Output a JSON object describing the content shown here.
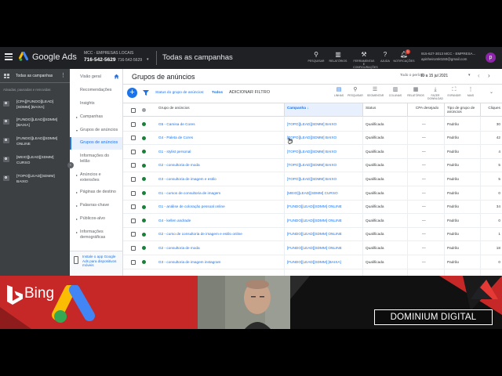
{
  "app": {
    "brand": "Google Ads",
    "account_line1": "MCC - EMPRESAS LOCAIS",
    "account_line2": "716-542-5629",
    "account_line3": "716-542-5629",
    "title": "Todas as campanhas",
    "tools": [
      {
        "label": "PESQUISAR",
        "icon": "search-icon"
      },
      {
        "label": "RELATÓRIOS",
        "icon": "reports-icon"
      },
      {
        "label": "FERRAMENTAS E CONFIGURAÇÕES",
        "icon": "tools-icon"
      },
      {
        "label": "AJUDA",
        "icon": "help-icon"
      },
      {
        "label": "NOTIFICAÇÕES",
        "icon": "bell-icon"
      }
    ],
    "notifications_badge": "1",
    "user_line1": "915-627-3013 MCC - EMPRESA...",
    "user_line2": "apinheiromkt150@gmail.com",
    "avatar_letter": "p"
  },
  "left_panel": {
    "title": "Todas as campanhas",
    "filter_text": "Ativadas, pausadas e removidas",
    "campaigns": [
      "[CPA][FUNDO][LEAD][SDMM] [BAIXA]",
      "[FUNDO][LEAD][SDMM] [BAIXA]",
      "[FUNDO][LEAD][SDMM] ONLINE",
      "[MEIO][LEAD][SDMM] CURSO",
      "[TOPO][LEAD][SDMM] BAIXO"
    ]
  },
  "nav": {
    "items": [
      {
        "label": "Visão geral",
        "arrow": ""
      },
      {
        "label": "Recomendações",
        "arrow": ""
      },
      {
        "label": "Insights",
        "arrow": ""
      },
      {
        "label": "Campanhas",
        "arrow": "▸"
      },
      {
        "label": "Grupos de anúncios",
        "arrow": "▾"
      },
      {
        "label": "Grupos de anúncios",
        "arrow": ""
      },
      {
        "label": "Informações do leilão",
        "arrow": ""
      },
      {
        "label": "Anúncios e extensões",
        "arrow": "▸"
      },
      {
        "label": "Páginas de destino",
        "arrow": "▸"
      },
      {
        "label": "Palavras-chave",
        "arrow": "▸"
      },
      {
        "label": "Públicos-alvo",
        "arrow": "▸"
      },
      {
        "label": "Informações demográficas",
        "arrow": "▸"
      }
    ],
    "bottom_text": "Instale o app Google Ads para dispositivos móveis"
  },
  "main": {
    "page_title": "Grupos de anúncios",
    "period_label": "Todo o período",
    "period_value": "11 a 15 jul 2021",
    "filter_text": "Status do grupo de anúncios:",
    "filter_value": "Todos",
    "add_filter": "ADICIONAR FILTRO",
    "tools": [
      {
        "label": "LINHAS",
        "icon": "rows-icon"
      },
      {
        "label": "PESQUISAR",
        "icon": "search-icon"
      },
      {
        "label": "SEGMENTAR",
        "icon": "segment-icon"
      },
      {
        "label": "COLUNAS",
        "icon": "columns-icon"
      },
      {
        "label": "RELATÓRIOS",
        "icon": "reports-icon"
      },
      {
        "label": "FAZER DOWNLOAD",
        "icon": "download-icon"
      },
      {
        "label": "EXPANDIR",
        "icon": "expand-icon"
      },
      {
        "label": "MAIS",
        "icon": "more-icon"
      }
    ],
    "table": {
      "headers": {
        "group": "Grupo de anúncios",
        "campaign": "Campanha",
        "status": "Status",
        "cpa": "CPA desejado",
        "type": "Tipo de grupo de anúncios",
        "clicks": "Cliques"
      },
      "rows": [
        {
          "group": "G5 - Camisa de Cores",
          "campaign": "[TOPO][LEAD][SDMM] BAIXO",
          "status": "Qualificada",
          "cpa": "—",
          "type": "Padrão",
          "clicks": "30"
        },
        {
          "group": "G4 - Paleta de Cores",
          "campaign": "[TOPO][LEAD][SDMM] BAIXO",
          "status": "Qualificada",
          "cpa": "—",
          "type": "Padrão",
          "clicks": "42"
        },
        {
          "group": "G1 - stylist personal",
          "campaign": "[TOPO][LEAD][SDMM] BAIXO",
          "status": "Qualificada",
          "cpa": "—",
          "type": "Padrão",
          "clicks": "4"
        },
        {
          "group": "G2 - consultoria de moda",
          "campaign": "[TOPO][LEAD][SDMM] BAIXO",
          "status": "Qualificada",
          "cpa": "—",
          "type": "Padrão",
          "clicks": "5"
        },
        {
          "group": "G3 - consultoria de imagem e estilo",
          "campaign": "[TOPO][LEAD][SDMM] BAIXO",
          "status": "Qualificada",
          "cpa": "—",
          "type": "Padrão",
          "clicks": "5"
        },
        {
          "group": "G1 - cursos de consultoria de imagem",
          "campaign": "[MEIO][LEAD][SDMM] CURSO",
          "status": "Qualificada",
          "cpa": "—",
          "type": "Padrão",
          "clicks": "0"
        },
        {
          "group": "G1 - análise de coloração pessoal online",
          "campaign": "[FUNDO][LEAD][SDMM] ONLINE",
          "status": "Qualificada",
          "cpa": "—",
          "type": "Padrão",
          "clicks": "34"
        },
        {
          "group": "G4 - kellen andrade",
          "campaign": "[FUNDO][LEAD][SDMM] ONLINE",
          "status": "Qualificada",
          "cpa": "—",
          "type": "Padrão",
          "clicks": "0"
        },
        {
          "group": "G2 - curso de consultoria de imagem e estilo online",
          "campaign": "[FUNDO][LEAD][SDMM] ONLINE",
          "status": "Qualificada",
          "cpa": "—",
          "type": "Padrão",
          "clicks": "1"
        },
        {
          "group": "G2 - consultoria de moda",
          "campaign": "[FUNDO][LEAD][SDMM] ONLINE",
          "status": "Qualificada",
          "cpa": "—",
          "type": "Padrão",
          "clicks": "18"
        },
        {
          "group": "G3 - consultoria de imagem instagram",
          "campaign": "[FUNDO][LEAD][SDMM] [BAIXA]",
          "status": "Qualificada",
          "cpa": "—",
          "type": "Padrão",
          "clicks": "0"
        }
      ]
    }
  },
  "overlay": {
    "bing_label": "Bing",
    "brand_label": "DOMINIUM DIGITAL",
    "colors": {
      "band": "#c62828",
      "google_blue": "#4285f4",
      "google_yellow": "#fbbc04",
      "google_green": "#34a853"
    }
  }
}
